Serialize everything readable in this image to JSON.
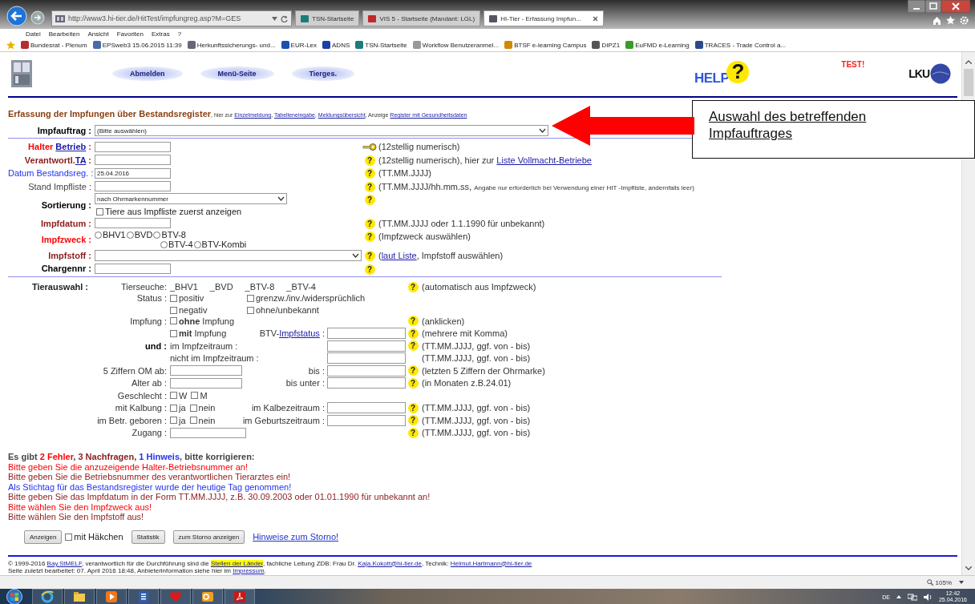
{
  "browser": {
    "address": "http://www3.hi-tier.de/HitTest/impfungreg.asp?M=GES",
    "tabs": [
      {
        "label": "TSN-Startseite",
        "selected": false
      },
      {
        "label": "VIS 5 - Startseite (Mandant: LGL)",
        "selected": false
      },
      {
        "label": "HI-Tier - Erfassung Impfun...",
        "selected": true
      }
    ],
    "menu": [
      "Datei",
      "Bearbeiten",
      "Ansicht",
      "Favoriten",
      "Extras",
      "?"
    ],
    "favorites": [
      "Bundesrat - Plenum",
      "EPSweb3 15.06.2015 11:39",
      "Herkunftssicherungs- und...",
      "EUR-Lex",
      "ADNS",
      "TSN-Startseite",
      "Workflow Benutzeranmel...",
      "BTSF e-learning Campus",
      "DIPZ1",
      "EuFMD e-Learning",
      "TRACES - Trade Control a..."
    ]
  },
  "header": {
    "nav": [
      "Abmelden",
      "Menü-Seite",
      "Tierges."
    ],
    "help": {
      "text": "HELP",
      "mark": "?"
    },
    "test": "TEST!",
    "logo": "LKU"
  },
  "title": {
    "heading": "Erfassung der Impfungen über Bestandsregister",
    "note": [
      {
        "kind": "text",
        "text": ", hier zur "
      },
      {
        "kind": "link",
        "text": "Einzelmeldung"
      },
      {
        "kind": "text",
        "text": ", "
      },
      {
        "kind": "link",
        "text": "Tabelleneingabe"
      },
      {
        "kind": "text",
        "text": ", "
      },
      {
        "kind": "link",
        "text": "Meldungsübersicht"
      },
      {
        "kind": "text",
        "text": ", Anzeige "
      },
      {
        "kind": "link",
        "text": "Register mit Gesundheitsdaten"
      }
    ]
  },
  "form": {
    "rows": [
      {
        "label": {
          "kind": "required",
          "parts": [
            {
              "kind": "text",
              "text": "Impfauftrag :"
            }
          ]
        },
        "field": {
          "kind": "select",
          "value": "(Bitte auswählen)"
        }
      },
      {
        "label": {
          "kind": "error",
          "parts": [
            {
              "kind": "text",
              "text": "Halter "
            },
            {
              "kind": "link",
              "text": "Betrieb"
            },
            {
              "kind": "text",
              "text": " :"
            }
          ]
        },
        "field": {
          "kind": "input"
        },
        "helper": {
          "kind": "key"
        },
        "hint": [
          {
            "kind": "text",
            "text": "(12stellig numerisch)"
          }
        ]
      },
      {
        "label": {
          "kind": "request",
          "parts": [
            {
              "kind": "text",
              "text": "Verantwortl."
            },
            {
              "kind": "link",
              "text": "TA"
            },
            {
              "kind": "text",
              "text": " :"
            }
          ]
        },
        "field": {
          "kind": "input"
        },
        "helper": {
          "kind": "question",
          "text": "?"
        },
        "hint": [
          {
            "kind": "text",
            "text": "(12stellig numerisch), hier zur "
          },
          {
            "kind": "link",
            "text": "Liste Vollmacht-Betriebe"
          }
        ]
      },
      {
        "label": {
          "kind": "note",
          "parts": [
            {
              "kind": "text",
              "text": "Datum Bestandsreg. :"
            }
          ]
        },
        "field": {
          "kind": "input",
          "value": "25.04.2016"
        },
        "helper": {
          "kind": "question",
          "text": "?"
        },
        "hint": [
          {
            "kind": "text",
            "text": "(TT.MM.JJJJ)"
          }
        ]
      },
      {
        "label": {
          "kind": "plain",
          "parts": [
            {
              "kind": "text",
              "text": "Stand Impfliste :"
            }
          ]
        },
        "field": {
          "kind": "input"
        },
        "helper": {
          "kind": "question",
          "text": "?"
        },
        "hint": [
          {
            "kind": "text",
            "text": "(TT.MM.JJJJ/hh.mm.ss, "
          },
          {
            "kind": "small",
            "text": "Angabe nur erforderlich bei Verwendung einer HIT -Impfliste, andernfalls leer)"
          }
        ]
      },
      {
        "label": {
          "kind": "required",
          "parts": [
            {
              "kind": "text",
              "text": "Sortierung :"
            }
          ]
        },
        "field": {
          "kind": "select",
          "value": "nach Ohrmarkennummer"
        },
        "helper": {
          "kind": "question",
          "text": "?"
        },
        "extra": {
          "label": "Tiere aus Impfliste zuerst anzeigen",
          "checked": false
        }
      },
      {
        "label": {
          "kind": "request",
          "parts": [
            {
              "kind": "text",
              "text": "Impfdatum :"
            }
          ]
        },
        "field": {
          "kind": "input"
        },
        "helper": {
          "kind": "question",
          "text": "?"
        },
        "hint": [
          {
            "kind": "text",
            "text": "(TT.MM.JJJJ oder 1.1.1990 für unbekannt)"
          }
        ]
      },
      {
        "label": {
          "kind": "error",
          "parts": [
            {
              "kind": "text",
              "text": "Impfzweck :"
            }
          ]
        },
        "field": {
          "kind": "radios",
          "options": [
            {
              "label": "BHV1",
              "selected": false
            },
            {
              "label": "BVD",
              "selected": false
            },
            {
              "label": "BTV-8",
              "selected": false
            },
            {
              "label": "BTV-4",
              "selected": false
            },
            {
              "label": "BTV-Kombi",
              "selected": false
            }
          ]
        },
        "helper": {
          "kind": "question",
          "text": "?"
        },
        "hint": [
          {
            "kind": "text",
            "text": "(Impfzweck auswählen)"
          }
        ]
      },
      {
        "label": {
          "kind": "request",
          "parts": [
            {
              "kind": "text",
              "text": "Impfstoff :"
            }
          ]
        },
        "field": {
          "kind": "select"
        },
        "helper": {
          "kind": "question",
          "text": "?"
        },
        "hint": [
          {
            "kind": "text",
            "text": "("
          },
          {
            "kind": "link",
            "text": "laut Liste"
          },
          {
            "kind": "text",
            "text": ", Impfstoff auswählen)"
          }
        ]
      },
      {
        "label": {
          "kind": "required",
          "parts": [
            {
              "kind": "text",
              "text": "Chargennr :"
            }
          ]
        },
        "field": {
          "kind": "input"
        },
        "helper": {
          "kind": "question",
          "text": "?"
        }
      }
    ]
  },
  "animal_selection": {
    "title": "Tierauswahl :",
    "rows": [
      {
        "label": "Tierseuche:",
        "left": [
          {
            "kind": "text",
            "text": "_BHV1"
          },
          {
            "kind": "text",
            "text": "_BVD"
          },
          {
            "kind": "text",
            "text": "_BTV-8"
          },
          {
            "kind": "text",
            "text": "_BTV-4"
          }
        ],
        "helper": {
          "kind": "question",
          "text": "?"
        },
        "hint": "(automatisch aus Impfzweck)"
      },
      {
        "label": "Status :",
        "left": [
          {
            "kind": "checkbox",
            "label": "positiv",
            "checked": false
          },
          {
            "kind": "checkbox",
            "label": "grenzw./inv./widersprüchlich",
            "checked": false
          },
          {
            "kind": "checkbox",
            "label": "negativ",
            "checked": false
          },
          {
            "kind": "checkbox",
            "label": "ohne/unbekannt",
            "checked": false
          }
        ]
      },
      {
        "label": "Impfung :",
        "left": [
          {
            "kind": "checkbox",
            "label": "**ohne** Impfung",
            "checked": false
          }
        ],
        "helper": {
          "kind": "question",
          "text": "?"
        },
        "hint": "(anklicken)"
      },
      {
        "left": [
          {
            "kind": "checkbox",
            "label": "**mit** Impfung",
            "checked": false
          }
        ],
        "mid": [
          {
            "kind": "text",
            "text": "BTV-"
          },
          {
            "kind": "link",
            "text": "Impfstatus"
          },
          {
            "kind": "text",
            "text": " :"
          }
        ],
        "field": {
          "kind": "input"
        },
        "helper": {
          "kind": "question",
          "text": "?"
        },
        "hint": "(mehrere mit Komma)"
      },
      {
        "label": "und :",
        "strong": true,
        "left": [
          {
            "kind": "text",
            "text": "im Impfzeitraum :"
          }
        ],
        "field": {
          "kind": "input"
        },
        "helper": {
          "kind": "question",
          "text": "?"
        },
        "hint": "(TT.MM.JJJJ, ggf. von - bis)"
      },
      {
        "left": [
          {
            "kind": "text",
            "text": "nicht im Impfzeitraum :"
          }
        ],
        "field": {
          "kind": "input"
        },
        "hint": "(TT.MM.JJJJ, ggf. von - bis)"
      },
      {
        "label": "5 Ziffern OM ab:",
        "left": [
          {
            "kind": "field"
          }
        ],
        "mid": [
          {
            "kind": "text",
            "text": "bis :"
          }
        ],
        "field": {
          "kind": "input"
        },
        "helper": {
          "kind": "question",
          "text": "?"
        },
        "hint": "(letzten 5 Ziffern der Ohrmarke)"
      },
      {
        "label": "Alter ab :",
        "left": [
          {
            "kind": "field"
          }
        ],
        "mid": [
          {
            "kind": "text",
            "text": "bis unter :"
          }
        ],
        "field": {
          "kind": "input"
        },
        "helper": {
          "kind": "question",
          "text": "?"
        },
        "hint": "(in Monaten z.B.24.01)"
      },
      {
        "label": "Geschlecht :",
        "left": [
          {
            "kind": "checkbox",
            "label": "W",
            "checked": false
          },
          {
            "kind": "checkbox",
            "label": "M",
            "checked": false
          }
        ]
      },
      {
        "label": "mit Kalbung :",
        "left": [
          {
            "kind": "checkbox",
            "label": "ja",
            "checked": false
          },
          {
            "kind": "checkbox",
            "label": "nein",
            "checked": false
          }
        ],
        "mid": [
          {
            "kind": "text",
            "text": "im Kalbezeitraum :"
          }
        ],
        "field": {
          "kind": "input"
        },
        "helper": {
          "kind": "question",
          "text": "?"
        },
        "hint": "(TT.MM.JJJJ, ggf. von - bis)"
      },
      {
        "label": "im Betr. geboren :",
        "left": [
          {
            "kind": "checkbox",
            "label": "ja",
            "checked": false
          },
          {
            "kind": "checkbox",
            "label": "nein",
            "checked": false
          }
        ],
        "mid": [
          {
            "kind": "text",
            "text": "im Geburtszeitraum :"
          }
        ],
        "field": {
          "kind": "input"
        },
        "helper": {
          "kind": "question",
          "text": "?"
        },
        "hint": "(TT.MM.JJJJ, ggf. von - bis)"
      },
      {
        "label": "Zugang :",
        "left": [
          {
            "kind": "field"
          }
        ],
        "helper": {
          "kind": "question",
          "text": "?"
        },
        "hint": "(TT.MM.JJJJ, ggf. von - bis)"
      }
    ]
  },
  "messages": {
    "summary": [
      {
        "kind": "plain",
        "text": "Es gibt "
      },
      {
        "kind": "error",
        "text": "2 Fehler"
      },
      {
        "kind": "plain",
        "text": ", "
      },
      {
        "kind": "request",
        "text": "3 Nachfragen"
      },
      {
        "kind": "plain",
        "text": ", "
      },
      {
        "kind": "note",
        "text": "1 Hinweis"
      },
      {
        "kind": "plain",
        "text": ", bitte korrigieren:"
      }
    ],
    "items": [
      {
        "kind": "error",
        "text": "Bitte geben Sie die anzuzeigende Halter-Betriebsnummer an!"
      },
      {
        "kind": "request",
        "text": "Bitte geben Sie die Betriebsnummer des verantwortlichen Tierarztes ein!"
      },
      {
        "kind": "note",
        "text": "Als Stichtag für das Bestandsregister wurde der heutige Tag genommen!"
      },
      {
        "kind": "request",
        "text": "Bitte geben Sie das Impfdatum in der Form TT.MM.JJJJ, z.B. 30.09.2003 oder 01.01.1990 für unbekannt an!"
      },
      {
        "kind": "error",
        "text": "Bitte wählen Sie den Impfzweck aus!"
      },
      {
        "kind": "request",
        "text": "Bitte wählen Sie den Impfstoff aus!"
      }
    ]
  },
  "actions": [
    {
      "kind": "button",
      "label": "Anzeigen"
    },
    {
      "kind": "checkbox",
      "label": "mit Häkchen",
      "checked": false
    },
    {
      "kind": "button",
      "label": "Statistik"
    },
    {
      "kind": "button",
      "label": "zum Storno anzeigen"
    },
    {
      "kind": "link",
      "label": "Hinweise zum Storno!"
    }
  ],
  "footer": [
    [
      {
        "kind": "text",
        "text": "© 1999-2016 "
      },
      {
        "kind": "link",
        "text": "Bay.StMELF"
      },
      {
        "kind": "text",
        "text": ", verantwortlich für die Durchführung sind die "
      },
      {
        "kind": "highlight",
        "text": "Stellen der Länder"
      },
      {
        "kind": "text",
        "text": ", fachliche Leitung ZDB: Frau Dr. "
      },
      {
        "kind": "link",
        "text": "Kaja.Kokott@hi-tier.de"
      },
      {
        "kind": "text",
        "text": ", Technik: "
      },
      {
        "kind": "link",
        "text": "Helmut.Hartmann@hi-tier.de"
      }
    ],
    [
      {
        "kind": "text",
        "text": "Seite zuletzt bearbeitet: 07. April 2016 18:48, Anbieterinformation siehe hier im "
      },
      {
        "kind": "link",
        "text": "Impressum"
      },
      {
        "kind": "text",
        "text": "."
      }
    ]
  ],
  "status_bar": {
    "zoom": "105%"
  },
  "taskbar": {
    "language": "DE",
    "time": "12:42",
    "date": "25.04.2016"
  },
  "annotation": {
    "text": "Auswahl des betreffenden Impfauftrages"
  }
}
